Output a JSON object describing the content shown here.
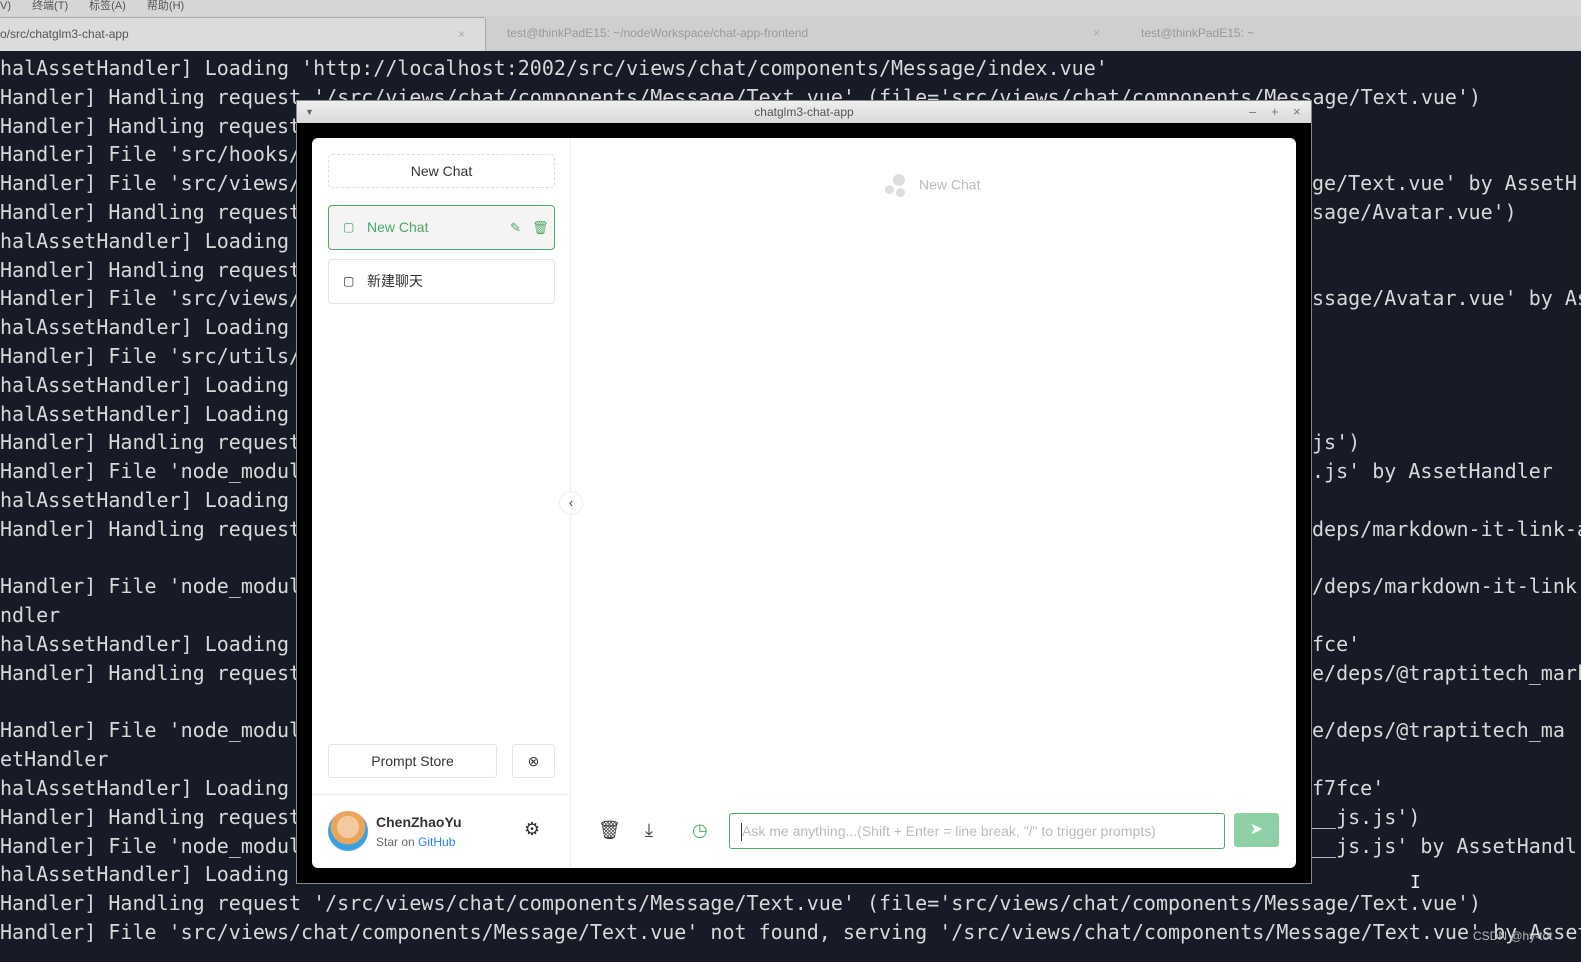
{
  "menubar": [
    "V)",
    "终端(T)",
    "标签(A)",
    "帮助(H)"
  ],
  "tabs": [
    {
      "label": "o/src/chatglm3-chat-app",
      "active": true
    },
    {
      "label": "test@thinkPadE15: ~/nodeWorkspace/chat-app-frontend",
      "active": false
    },
    {
      "label": "test@thinkPadE15: ~",
      "active": false
    }
  ],
  "tab_close": "×",
  "terminal": {
    "left": [
      "halAssetHandler] Loading 'http://localhost:2002/src/views/chat/components/Message/index.vue'",
      "Handler] Handling request '/src/views/chat/components/Message/Text.vue' (file='src/views/chat/components/Message/Text.vue')",
      "Handler] Handling request",
      "Handler] File 'src/hooks/(",
      "Handler] File 'src/views/(",
      "Handler] Handling request",
      "halAssetHandler] Loading",
      "Handler] Handling request",
      "Handler] File 'src/views/(",
      "halAssetHandler] Loading",
      "Handler] File 'src/utils/(",
      "halAssetHandler] Loading",
      "halAssetHandler] Loading",
      "Handler] Handling request",
      "Handler] File 'node_modul(",
      "halAssetHandler] Loading",
      "Handler] Handling request",
      "",
      "Handler] File 'node_modul(",
      "ndler",
      "halAssetHandler] Loading",
      "Handler] Handling request",
      "",
      "Handler] File 'node_modul(",
      "etHandler",
      "halAssetHandler] Loading",
      "Handler] Handling request",
      "Handler] File 'node_modul(",
      "halAssetHandler] Loading",
      "Handler] Handling request '/src/views/chat/components/Message/Text.vue' (file='src/views/chat/components/Message/Text.vue')",
      "Handler] File 'src/views/chat/components/Message/Text.vue' not found, serving '/src/views/chat/components/Message/Text.vue' by AssetH"
    ],
    "right": [
      "",
      "",
      "",
      "",
      "ge/Text.vue' by AssetH",
      "sage/Avatar.vue')",
      "",
      "",
      "ssage/Avatar.vue' by As",
      "",
      "",
      "",
      "",
      "js')",
      ".js' by AssetHandler",
      "",
      "deps/markdown-it-link-a",
      "",
      "/deps/markdown-it-link",
      "",
      "fce'",
      "e/deps/@traptitech_mark",
      "",
      "e/deps/@traptitech_ma",
      "",
      "f7fce'",
      "__js.js')",
      "__js.js' by AssetHandl",
      "",
      "",
      ""
    ]
  },
  "window": {
    "title": "chatglm3-chat-app",
    "menu": "▼",
    "minimize": "–",
    "maximize": "+",
    "close": "×"
  },
  "sidebar": {
    "new_chat_label": "New Chat",
    "items": [
      {
        "label": "New Chat",
        "active": true
      },
      {
        "label": "新建聊天",
        "active": false
      }
    ],
    "prompt_store_label": "Prompt Store",
    "clear_icon": "⊗",
    "user": {
      "name": "ChenZhaoYu",
      "star_prefix": "Star on ",
      "star_link": "GitHub"
    },
    "collapse_icon": "‹"
  },
  "main": {
    "header_title": "New Chat",
    "input_placeholder": "Ask me anything...(Shift + Enter = line break, \"/\" to trigger prompts)",
    "send_icon": "➤"
  },
  "colors": {
    "accent": "#4ea866",
    "link": "#2080f0",
    "send": "#8fd1a6",
    "terminal_bg": "#161b27"
  },
  "watermark": "CSDN @hy-tot"
}
